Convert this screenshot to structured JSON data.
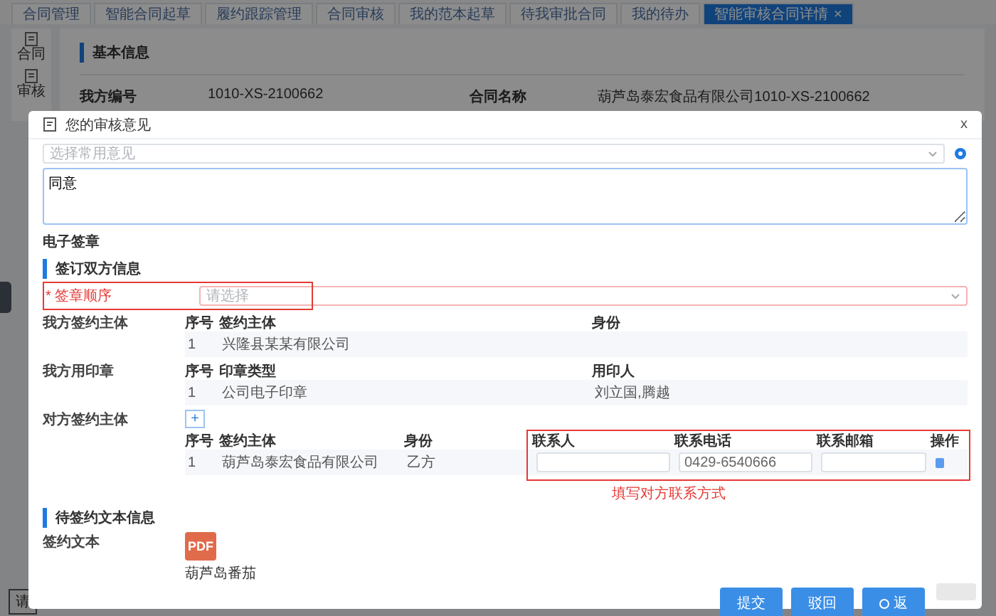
{
  "tabs": [
    {
      "label": "合同管理",
      "selected": false
    },
    {
      "label": "智能合同起草",
      "selected": false
    },
    {
      "label": "履约跟踪管理",
      "selected": false
    },
    {
      "label": "合同审核",
      "selected": false
    },
    {
      "label": "我的范本起草",
      "selected": false
    },
    {
      "label": "待我审批合同",
      "selected": false
    },
    {
      "label": "我的待办",
      "selected": false
    },
    {
      "label": "智能审核合同详情",
      "selected": true,
      "close": "×"
    }
  ],
  "sidebar": [
    {
      "label": "合同"
    },
    {
      "label": "审核"
    }
  ],
  "background": {
    "section_title": "基本信息",
    "fields": [
      {
        "label": "我方编号",
        "value": "1010-XS-2100662"
      },
      {
        "label": "合同名称",
        "value": "葫芦岛泰宏食品有限公司1010-XS-2100662"
      }
    ],
    "footer_fragment": "请"
  },
  "dialog": {
    "title": "您的审核意见",
    "close": "x",
    "opinion_select": {
      "placeholder": "选择常用意见"
    },
    "opinion_text": {
      "value": "同意"
    },
    "esign_title": "电子签章",
    "party_section_title": "签订双方信息",
    "seal_order": {
      "label": "签章顺序",
      "required": true,
      "required_mark": "*",
      "placeholder": "请选择"
    },
    "our_subject": {
      "label": "我方签约主体",
      "columns": [
        "序号",
        "签约主体",
        "身份"
      ],
      "rows": [
        [
          "1",
          "兴隆县某某有限公司"
        ]
      ]
    },
    "our_seal": {
      "label": "我方用印章",
      "columns": [
        "序号",
        "印章类型",
        "用印人"
      ],
      "rows": [
        [
          "1",
          "公司电子印章",
          "刘立国,腾越"
        ]
      ]
    },
    "counterparty": {
      "label": "对方签约主体",
      "add": "+",
      "columns": [
        "序号",
        "签约主体",
        "身份",
        "联系人",
        "联系电话",
        "联系邮箱",
        "操作"
      ],
      "rows": [
        {
          "cells": [
            "1",
            "葫芦岛泰宏食品有限公司",
            "乙方"
          ],
          "contact_fields": [
            {
              "kind": "empty"
            },
            {
              "kind": "filled",
              "value": "0429-6540666"
            },
            {
              "kind": "empty"
            }
          ]
        }
      ]
    },
    "annotation": "填写对方联系方式",
    "text_section_title": "待签约文本信息",
    "document": {
      "label": "签约文本",
      "badge": "PDF",
      "file_name": "葫芦岛番茄"
    },
    "buttons": [
      {
        "label": "提交",
        "kind": "primary"
      },
      {
        "label": "驳回",
        "kind": "primary"
      },
      {
        "label": "返",
        "kind": "icon"
      }
    ]
  }
}
